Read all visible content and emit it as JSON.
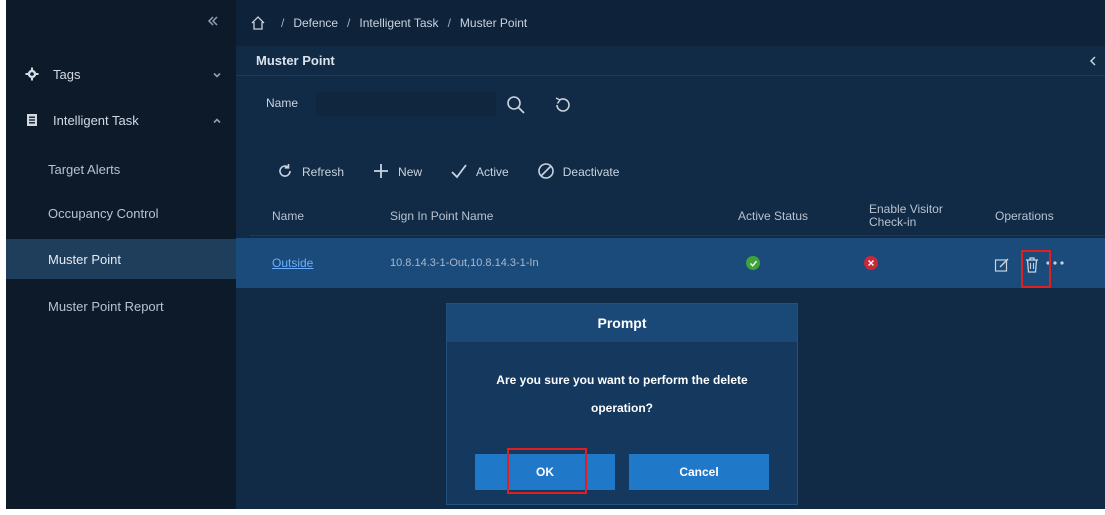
{
  "sidebar": {
    "groups": [
      {
        "label": "Tags",
        "icon": "gear-icon",
        "expanded": false
      },
      {
        "label": "Intelligent Task",
        "icon": "clipboard-icon",
        "expanded": true
      }
    ],
    "items": [
      {
        "label": "Target Alerts",
        "active": false
      },
      {
        "label": "Occupancy Control",
        "active": false
      },
      {
        "label": "Muster Point",
        "active": true
      },
      {
        "label": "Muster Point Report",
        "active": false
      }
    ]
  },
  "breadcrumb": {
    "items": [
      "Defence",
      "Intelligent Task",
      "Muster Point"
    ],
    "separator": "/"
  },
  "page": {
    "title": "Muster Point"
  },
  "filter": {
    "name_label": "Name",
    "name_value": ""
  },
  "toolbar": {
    "refresh_label": "Refresh",
    "new_label": "New",
    "active_label": "Active",
    "deactivate_label": "Deactivate"
  },
  "table": {
    "columns": [
      "Name",
      "Sign In Point Name",
      "Active Status",
      "Enable Visitor Check-in",
      "Operations"
    ],
    "rows": [
      {
        "name": "Outside",
        "sign_in_point_name": "10.8.14.3-1-Out,10.8.14.3-1-In",
        "active_status": "active",
        "enable_visitor_checkin": "disabled"
      }
    ]
  },
  "dialog": {
    "title": "Prompt",
    "message": "Are you sure you want to perform the delete operation?",
    "ok_label": "OK",
    "cancel_label": "Cancel"
  },
  "colors": {
    "accent": "#1f78c8",
    "status_ok": "#3fa33a",
    "status_off": "#c8283a",
    "highlight": "#e02020",
    "link": "#6ab0ff"
  }
}
